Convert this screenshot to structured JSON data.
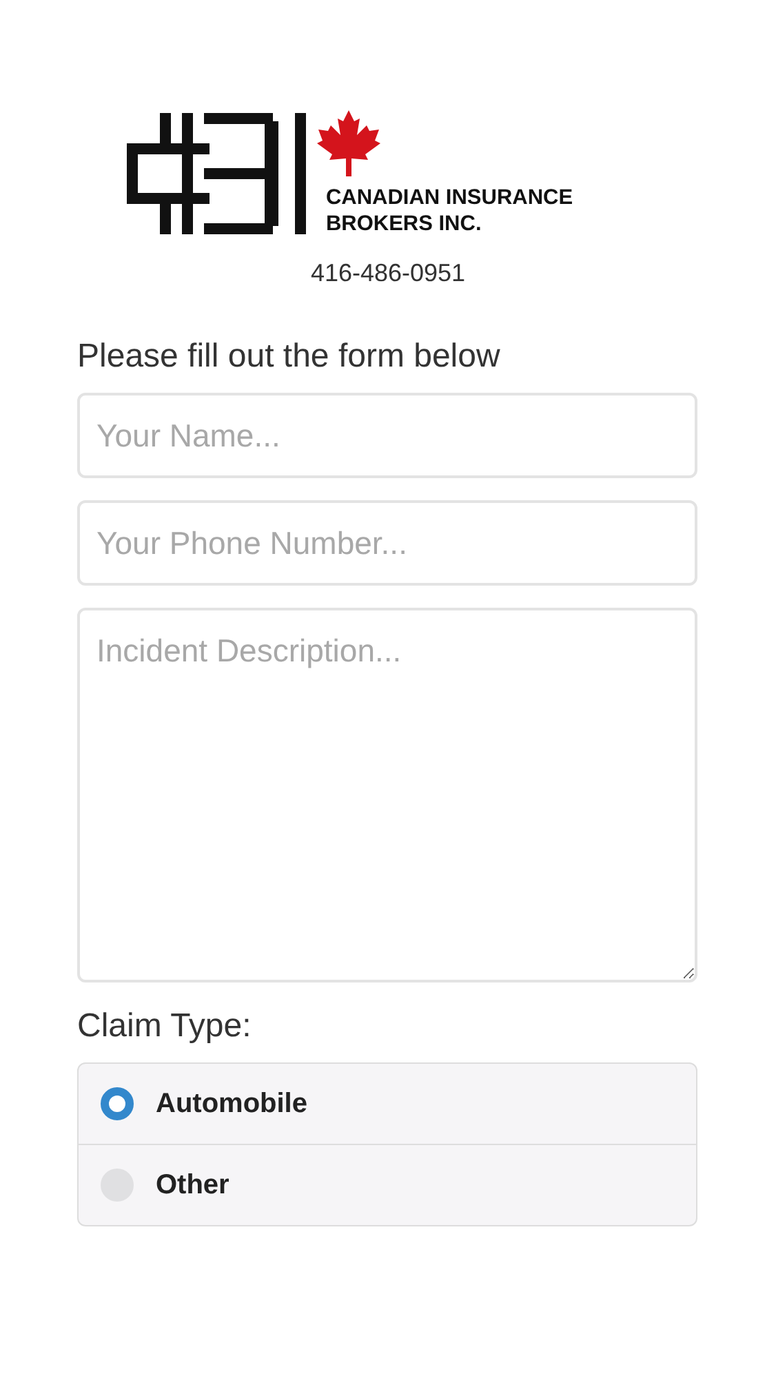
{
  "logo": {
    "company_line_1": "CANADIAN INSURANCE",
    "company_line_2": "BROKERS INC."
  },
  "phone": "416-486-0951",
  "form": {
    "heading": "Please fill out the form below",
    "fields": [
      {
        "kind": "input",
        "placeholder": "Your Name..."
      },
      {
        "kind": "input",
        "placeholder": "Your Phone Number..."
      },
      {
        "kind": "textarea",
        "placeholder": "Incident Description..."
      }
    ],
    "claim_label": "Claim Type:",
    "claim_options": [
      {
        "label": "Automobile",
        "selected": true
      },
      {
        "label": "Other",
        "selected": false
      }
    ]
  }
}
